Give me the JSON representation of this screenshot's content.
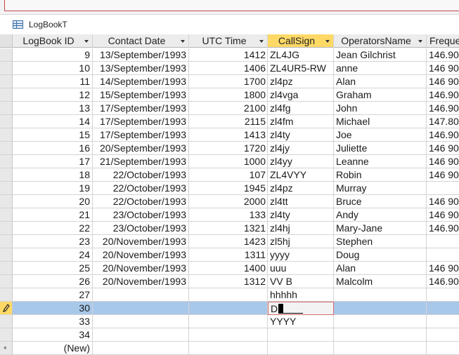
{
  "table_tab": {
    "label": "LogBookT"
  },
  "columns": [
    {
      "label": "LogBook ID",
      "id": "logbook_id",
      "has_dropdown": true
    },
    {
      "label": "Contact Date",
      "id": "contact_date",
      "has_dropdown": true
    },
    {
      "label": "UTC Time",
      "id": "utc_time",
      "has_dropdown": true
    },
    {
      "label": "CallSign",
      "id": "callsign",
      "has_dropdown": true,
      "active": true
    },
    {
      "label": "OperatorsName",
      "id": "operators_name",
      "has_dropdown": true
    },
    {
      "label": "Freque",
      "id": "frequency",
      "has_dropdown": false
    }
  ],
  "rows": [
    {
      "id": "9",
      "date": "13/September/1993",
      "time": "1412",
      "callsign": "ZL4JG",
      "operator": "Jean Gilchrist",
      "freq": "146.90"
    },
    {
      "id": "10",
      "date": "13/September/1993",
      "time": "1406",
      "callsign": "ZL4UR5-RW",
      "operator": "anne",
      "freq": "146 90"
    },
    {
      "id": "11",
      "date": "14/September/1993",
      "time": "1700",
      "callsign": "zl4pz",
      "operator": "Alan",
      "freq": "146 90"
    },
    {
      "id": "12",
      "date": "15/September/1993",
      "time": "1800",
      "callsign": "zl4vga",
      "operator": "Graham",
      "freq": "146.90"
    },
    {
      "id": "13",
      "date": "17/September/1993",
      "time": "2100",
      "callsign": "zl4fg",
      "operator": "John",
      "freq": "146.90"
    },
    {
      "id": "14",
      "date": "17/September/1993",
      "time": "2115",
      "callsign": "zl4fm",
      "operator": "Michael",
      "freq": "147.80"
    },
    {
      "id": "15",
      "date": "17/September/1993",
      "time": "1413",
      "callsign": "zl4ty",
      "operator": "Joe",
      "freq": "146.90"
    },
    {
      "id": "16",
      "date": "20/September/1993",
      "time": "1720",
      "callsign": "zl4jy",
      "operator": "Juliette",
      "freq": "146 90"
    },
    {
      "id": "17",
      "date": "21/September/1993",
      "time": "1000",
      "callsign": "zl4yy",
      "operator": "Leanne",
      "freq": "146 90"
    },
    {
      "id": "18",
      "date": "22/October/1993",
      "time": "107",
      "callsign": "ZL4VYY",
      "operator": "Robin",
      "freq": "146 90"
    },
    {
      "id": "19",
      "date": "22/October/1993",
      "time": "1945",
      "callsign": "zl4pz",
      "operator": "Murray",
      "freq": ""
    },
    {
      "id": "20",
      "date": "22/October/1993",
      "time": "2000",
      "callsign": "zl4tt",
      "operator": "Bruce",
      "freq": "146 90"
    },
    {
      "id": "21",
      "date": "23/October/1993",
      "time": "133",
      "callsign": "zl4ty",
      "operator": "Andy",
      "freq": "146 90"
    },
    {
      "id": "22",
      "date": "23/October/1993",
      "time": "1321",
      "callsign": "zl4hj",
      "operator": "Mary-Jane",
      "freq": "146.90"
    },
    {
      "id": "23",
      "date": "20/November/1993",
      "time": "1423",
      "callsign": "zl5hj",
      "operator": "Stephen",
      "freq": ""
    },
    {
      "id": "24",
      "date": "20/November/1993",
      "time": "1311",
      "callsign": "yyyy",
      "operator": "Doug",
      "freq": ""
    },
    {
      "id": "25",
      "date": "20/November/1993",
      "time": "1400",
      "callsign": "uuu",
      "operator": "Alan",
      "freq": "146 90"
    },
    {
      "id": "26",
      "date": "20/November/1993",
      "time": "1312",
      "callsign": "VV B",
      "operator": "Malcolm",
      "freq": "146.90"
    },
    {
      "id": "27",
      "date": "",
      "time": "",
      "callsign": "hhhhh",
      "operator": "",
      "freq": ""
    },
    {
      "id": "30",
      "date": "",
      "time": "",
      "callsign": "D",
      "operator": "",
      "freq": "",
      "current": true
    },
    {
      "id": "33",
      "date": "",
      "time": "",
      "callsign": "YYYY",
      "operator": "",
      "freq": ""
    },
    {
      "id": "34",
      "date": "",
      "time": "",
      "callsign": "",
      "operator": "",
      "freq": ""
    },
    {
      "id": "(New)",
      "date": "",
      "time": "",
      "callsign": "",
      "operator": "",
      "freq": "",
      "new": true
    }
  ],
  "colors": {
    "header_bg": "#ececec",
    "active_header": "#ffd966",
    "current_row": "#a8c8ea",
    "edit_border": "#d86a6a"
  }
}
